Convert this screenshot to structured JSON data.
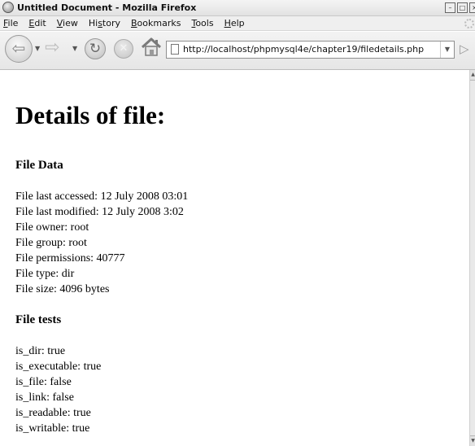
{
  "window": {
    "title": "Untitled Document - Mozilla Firefox"
  },
  "menu": [
    "File",
    "Edit",
    "View",
    "History",
    "Bookmarks",
    "Tools",
    "Help"
  ],
  "menu_access_keys": [
    "F",
    "E",
    "V",
    "s",
    "B",
    "T",
    "H"
  ],
  "address_bar": {
    "url": "http://localhost/phpmysql4e/chapter19/filedetails.php"
  },
  "page": {
    "heading": "Details of file:",
    "file_data": {
      "title": "File Data",
      "lines": [
        "File last accessed: 12 July 2008 03:01",
        "File last modified: 12 July 2008 3:02",
        "File owner: root",
        "File group: root",
        "File permissions: 40777",
        "File type: dir",
        "File size: 4096 bytes"
      ]
    },
    "file_tests": {
      "title": "File tests",
      "lines": [
        "is_dir: true",
        "is_executable: true",
        "is_file: false",
        "is_link: false",
        "is_readable: true",
        "is_writable: true"
      ]
    }
  },
  "icons": {
    "app": "firefox-icon",
    "back": "back-arrow-icon",
    "forward": "forward-arrow-icon",
    "reload": "reload-icon",
    "stop": "stop-icon",
    "home": "home-icon",
    "page": "page-icon",
    "go": "go-arrow-icon",
    "minimize": "minimize-icon",
    "maximize": "maximize-icon",
    "close": "close-icon",
    "throbber": "throbber-icon"
  }
}
